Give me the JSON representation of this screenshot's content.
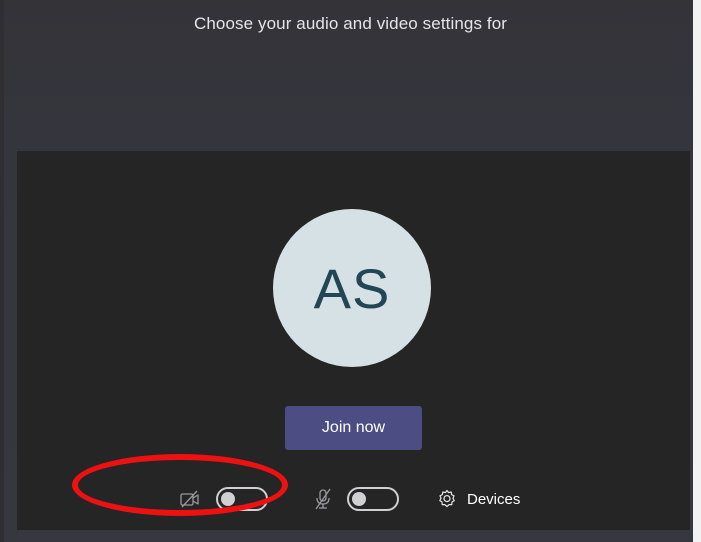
{
  "header": {
    "title": "Choose your audio and video settings for"
  },
  "preview": {
    "avatar_initials": "AS"
  },
  "actions": {
    "join_label": "Join now"
  },
  "controls": {
    "camera": {
      "icon": "camera-off-icon",
      "enabled": false
    },
    "microphone": {
      "icon": "mic-off-icon",
      "enabled": false
    },
    "devices": {
      "icon": "gear-icon",
      "label": "Devices"
    }
  },
  "colors": {
    "background": "#37373f",
    "preview_background": "#252525",
    "avatar_background": "#d6e1e5",
    "avatar_text": "#234655",
    "join_button": "#4b4d83",
    "annotation": "#ee1111"
  }
}
